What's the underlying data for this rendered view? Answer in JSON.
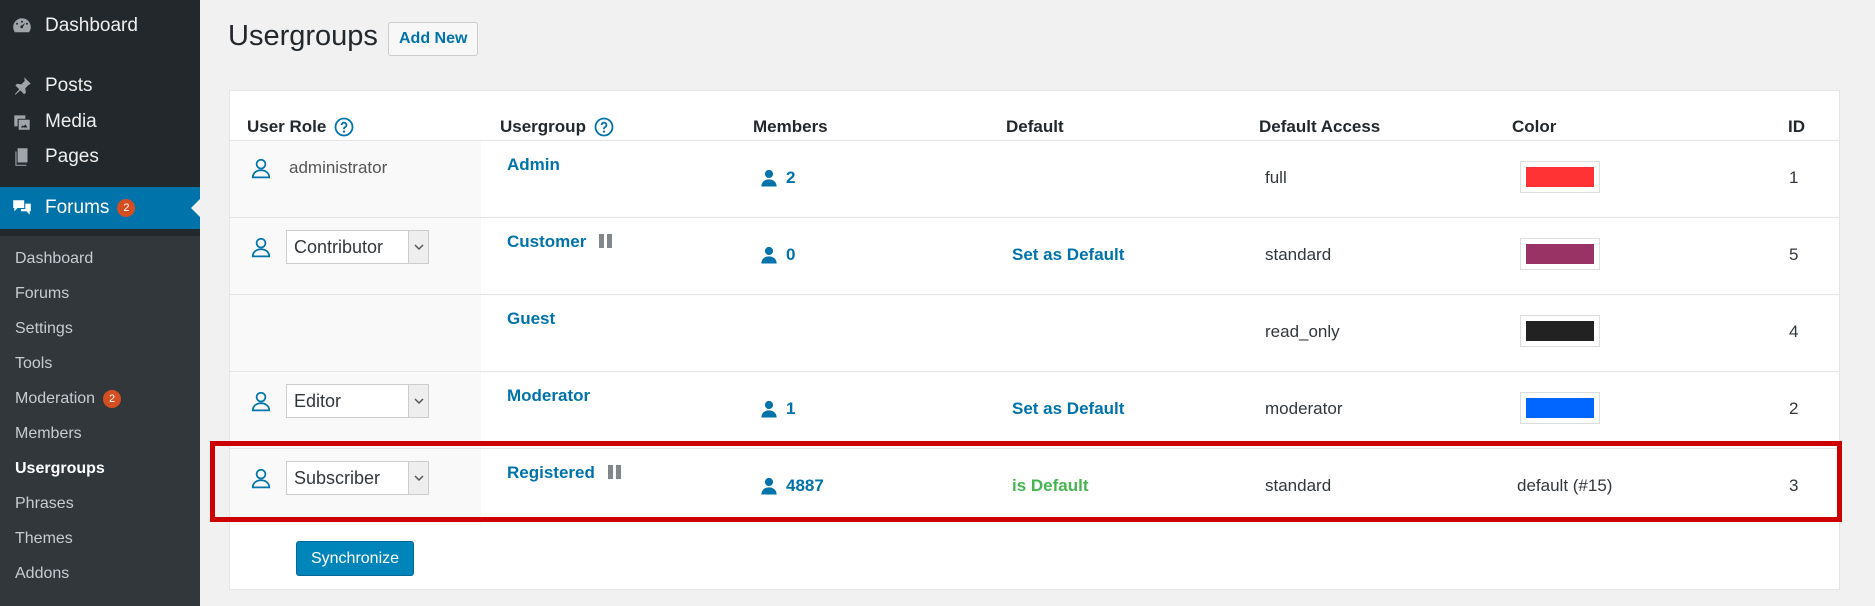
{
  "sidebar": {
    "top_items": [
      {
        "label": "Dashboard",
        "icon": "dashboard-icon"
      },
      {
        "label": "Posts",
        "icon": "pin-icon"
      },
      {
        "label": "Media",
        "icon": "media-icon"
      },
      {
        "label": "Pages",
        "icon": "pages-icon"
      },
      {
        "label": "Forums",
        "icon": "forums-icon",
        "badge": "2"
      }
    ],
    "sub_items": [
      {
        "label": "Dashboard"
      },
      {
        "label": "Forums"
      },
      {
        "label": "Settings"
      },
      {
        "label": "Tools"
      },
      {
        "label": "Moderation",
        "badge": "2"
      },
      {
        "label": "Members"
      },
      {
        "label": "Usergroups"
      },
      {
        "label": "Phrases"
      },
      {
        "label": "Themes"
      },
      {
        "label": "Addons"
      }
    ]
  },
  "page": {
    "title": "Usergroups",
    "add_new": "Add New"
  },
  "table": {
    "headers": {
      "user_role": "User Role",
      "usergroup": "Usergroup",
      "members": "Members",
      "default": "Default",
      "default_access": "Default Access",
      "color": "Color",
      "id": "ID"
    },
    "rows": [
      {
        "role": "administrator",
        "usergroup": "Admin",
        "members": "2",
        "default": "",
        "access": "full",
        "color": "#ff3333",
        "color_text": "",
        "id": "1"
      },
      {
        "role": "Contributor",
        "usergroup": "Customer",
        "members": "0",
        "default": "Set as Default",
        "access": "standard",
        "color": "#993366",
        "color_text": "",
        "id": "5"
      },
      {
        "role": "",
        "usergroup": "Guest",
        "members": "",
        "default": "",
        "access": "read_only",
        "color": "#222222",
        "color_text": "",
        "id": "4"
      },
      {
        "role": "Editor",
        "usergroup": "Moderator",
        "members": "1",
        "default": "Set as Default",
        "access": "moderator",
        "color": "#0066ff",
        "color_text": "",
        "id": "2"
      },
      {
        "role": "Subscriber",
        "usergroup": "Registered",
        "members": "4887",
        "default": "is Default",
        "access": "standard",
        "color": "",
        "color_text": "default (#15)",
        "id": "3"
      }
    ]
  },
  "actions": {
    "synchronize": "Synchronize"
  },
  "colors": {
    "sidebar_bg": "#23282d",
    "submenu_bg": "#32373c",
    "accent": "#0073aa",
    "badge": "#d54e21",
    "default_green": "#46b450",
    "highlight_red": "#cc0000"
  }
}
